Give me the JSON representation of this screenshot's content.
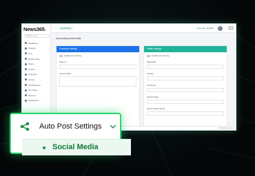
{
  "app": {
    "brand_main": "News365",
    "brand_accent": ".",
    "search_placeholder": "Search menu..."
  },
  "sidebar": {
    "items": [
      {
        "label": "Dashboard",
        "icon": "dashboard-icon"
      },
      {
        "label": "Category",
        "icon": "category-icon"
      },
      {
        "label": "Post",
        "icon": "post-icon"
      },
      {
        "label": "Media Library",
        "icon": "media-icon"
      },
      {
        "label": "Pages",
        "icon": "pages-icon"
      },
      {
        "label": "Opinion",
        "icon": "opinion-icon"
      },
      {
        "label": "Language",
        "icon": "language-icon"
      },
      {
        "label": "Archive",
        "icon": "archive-icon"
      },
      {
        "label": "Advertisement",
        "icon": "ads-icon"
      },
      {
        "label": "Seo Setup",
        "icon": "seo-icon"
      },
      {
        "label": "Reporter",
        "icon": "reporter-icon"
      },
      {
        "label": "Appearance",
        "icon": "appearance-icon"
      }
    ]
  },
  "topbar": {
    "back": "←",
    "dashboard_label": "Dashboard",
    "view_site": "View Site",
    "language": "English",
    "user_name": "Admin",
    "user_role": "Admin"
  },
  "content": {
    "page_title": "Auto posting social media",
    "left_panel": {
      "title": "Facebook settings",
      "toggle_label": "Enable Auto Posting",
      "fields": [
        {
          "label": "Page Id"
        },
        {
          "label": "Access Token"
        }
      ]
    },
    "right_panel": {
      "title": "Twitter settings",
      "toggle_label": "Enable Auto Posting",
      "fields": [
        {
          "label": "Page Path"
        },
        {
          "label": "Api Key"
        },
        {
          "label": "Api Secret"
        },
        {
          "label": "Access Token"
        },
        {
          "label": "Access Token Secret"
        }
      ]
    }
  },
  "footer": {
    "copyright": "© All rights reserved"
  },
  "callout": {
    "title": "Auto Post Settings",
    "sub_item": "Social Media",
    "colors": {
      "border": "#2bd36b",
      "sub_text": "#0f7a3a",
      "sub_bg": "#eaf8ef"
    }
  }
}
